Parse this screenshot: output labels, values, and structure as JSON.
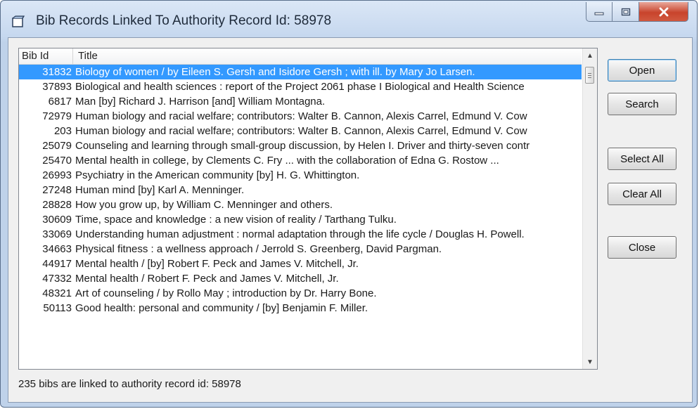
{
  "window": {
    "title": "Bib Records Linked To Authority Record Id: 58978"
  },
  "list": {
    "columns": [
      "Bib Id",
      "Title"
    ],
    "rows": [
      {
        "id": "31832",
        "title": "Biology of women / by Eileen S. Gersh and Isidore Gersh ; with ill. by Mary Jo Larsen.",
        "selected": true
      },
      {
        "id": "37893",
        "title": "Biological and health sciences : report of the Project 2061 phase I Biological and Health Science"
      },
      {
        "id": "6817",
        "title": "Man [by] Richard J. Harrison [and] William Montagna."
      },
      {
        "id": "72979",
        "title": "Human biology and racial welfare; contributors: Walter B. Cannon, Alexis Carrel, Edmund V. Cow"
      },
      {
        "id": "203",
        "title": "Human biology and racial welfare; contributors: Walter B. Cannon, Alexis Carrel, Edmund V. Cow"
      },
      {
        "id": "25079",
        "title": "Counseling and learning through small-group discussion, by Helen I. Driver and thirty-seven contr"
      },
      {
        "id": "25470",
        "title": "Mental health in college, by Clements C. Fry ... with the collaboration of Edna G. Rostow ..."
      },
      {
        "id": "26993",
        "title": "Psychiatry in the American community [by] H. G. Whittington."
      },
      {
        "id": "27248",
        "title": "Human mind [by] Karl A. Menninger."
      },
      {
        "id": "28828",
        "title": "How you grow up, by William C. Menninger and others."
      },
      {
        "id": "30609",
        "title": "Time, space and knowledge : a new vision of reality / Tarthang Tulku."
      },
      {
        "id": "33069",
        "title": "Understanding human adjustment : normal adaptation through the life cycle / Douglas H. Powell."
      },
      {
        "id": "34663",
        "title": "Physical fitness : a wellness approach / Jerrold S. Greenberg, David Pargman."
      },
      {
        "id": "44917",
        "title": "Mental health / [by] Robert F. Peck and James V. Mitchell, Jr."
      },
      {
        "id": "47332",
        "title": "Mental health / Robert F. Peck and James V. Mitchell, Jr."
      },
      {
        "id": "48321",
        "title": "Art of counseling / by Rollo May ; introduction by Dr. Harry Bone."
      },
      {
        "id": "50113",
        "title": "Good health: personal and community / [by] Benjamin F. Miller."
      }
    ]
  },
  "buttons": {
    "open": "Open",
    "search": "Search",
    "select_all": "Select All",
    "clear_all": "Clear All",
    "close": "Close"
  },
  "status": "235 bibs are linked to authority record id: 58978",
  "colors": {
    "selection": "#3399ff",
    "window_frame": "#bfd2ea",
    "close_button": "#c8442c"
  }
}
